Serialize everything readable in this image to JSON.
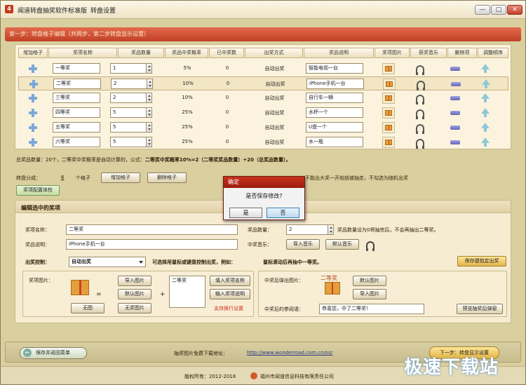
{
  "window": {
    "title": "闻道转盘抽奖软件标准版",
    "menu": "转盘设置",
    "min_label": "—",
    "restore_label": "▢",
    "close_label": "✕"
  },
  "step_header": "第一步：转盘格子编辑（共两步，第二步转盘显示设置）",
  "columns": [
    "增加格子",
    "奖项名称",
    "奖品数量",
    "奖品中奖概率",
    "已中奖数",
    "出奖方式",
    "奖品说明",
    "奖项图片",
    "获奖音乐",
    "删除项",
    "调整顺序"
  ],
  "rows": [
    {
      "name": "一等奖",
      "qty": "1",
      "rate": "5%",
      "won": "0",
      "mode": "自动出奖",
      "desc": "智能电视一台"
    },
    {
      "name": "二等奖",
      "qty": "2",
      "rate": "10%",
      "won": "0",
      "mode": "自动出奖",
      "desc": "iPhone手机一台"
    },
    {
      "name": "三等奖",
      "qty": "2",
      "rate": "10%",
      "won": "0",
      "mode": "自动出奖",
      "desc": "自行车一辆"
    },
    {
      "name": "四等奖",
      "qty": "5",
      "rate": "25%",
      "won": "0",
      "mode": "自动出奖",
      "desc": "水杯一个"
    },
    {
      "name": "五等奖",
      "qty": "5",
      "rate": "25%",
      "won": "0",
      "mode": "自动出奖",
      "desc": "U盘一个"
    },
    {
      "name": "六等奖",
      "qty": "5",
      "rate": "25%",
      "won": "0",
      "mode": "自动出奖",
      "desc": "水一瓶"
    }
  ],
  "summary": {
    "pre": "总奖品数量：20个，二等奖中奖概率是自动计算的，公式：",
    "bold": "二等奖中奖概率10%=2（二等奖奖品数量）÷20（总奖品数量）。"
  },
  "wheel": {
    "label": "转盘分成：",
    "count": "6",
    "unit": "个格子",
    "add_btn": "增加格子",
    "del_btn": "删除格子",
    "note": "不能出大奖一开始就被抽走，不勾选为随机出奖"
  },
  "check_btn": "奖项配置体检",
  "edit": {
    "title": "编辑选中的奖项",
    "name_label": "奖项名称：",
    "name_value": "二等奖",
    "desc_label": "奖品说明：",
    "desc_value": "iPhone手机一台",
    "qty_label": "奖品数量：",
    "qty_value": "2",
    "qty_hint": "奖品数量设为0将抽完后，不会再抽出二等奖。",
    "music_label": "中奖音乐：",
    "import_music": "导入音乐",
    "default_music": "默认音乐",
    "control_label": "出奖控制：",
    "control_value": "自动出奖",
    "control_hint_a": "可选择用鼠标或键盘控制出奖，例如：",
    "control_hint_b": "鼠标滚动后再抽中一等奖。",
    "hotkey_btn": "保存键指定出奖",
    "img_label": "奖项图片：",
    "import_img": "导入图片",
    "default_img": "默认图片",
    "no_img": "无图",
    "no_text_img": "无奖图片",
    "img_text": "二等奖",
    "fill_name": "填入奖项名称",
    "fill_desc": "输入奖项说明",
    "newline": "支持换行设置",
    "popup_label": "中奖后弹出图片：",
    "popup_default": "默认图片",
    "popup_import": "导入图片",
    "popup_img_text": "二等奖",
    "reply_label": "中奖后的参阅语：",
    "reply_value": "恭喜您，中了二等奖!",
    "preview_btn": "预览抽奖后弹窗"
  },
  "bottom": {
    "save_back": "保存并返回菜单",
    "url_label": "抽奖图片免费下载地址：",
    "url": "http://www.wonderroad.com.cn/oz/",
    "next": "下一步：转盘显示设置"
  },
  "footer": {
    "copyright": "版权所有：2012-2018",
    "company": "福州市闻道信息科技有限责任公司"
  },
  "dialog": {
    "title": "确定",
    "message": "是否保存修改?",
    "yes": "是",
    "no": "否"
  },
  "watermark": "极速下载站",
  "colors": {
    "accent": "#c14026",
    "panel": "#fbf3dd",
    "dialog_title": "#b2260f"
  }
}
